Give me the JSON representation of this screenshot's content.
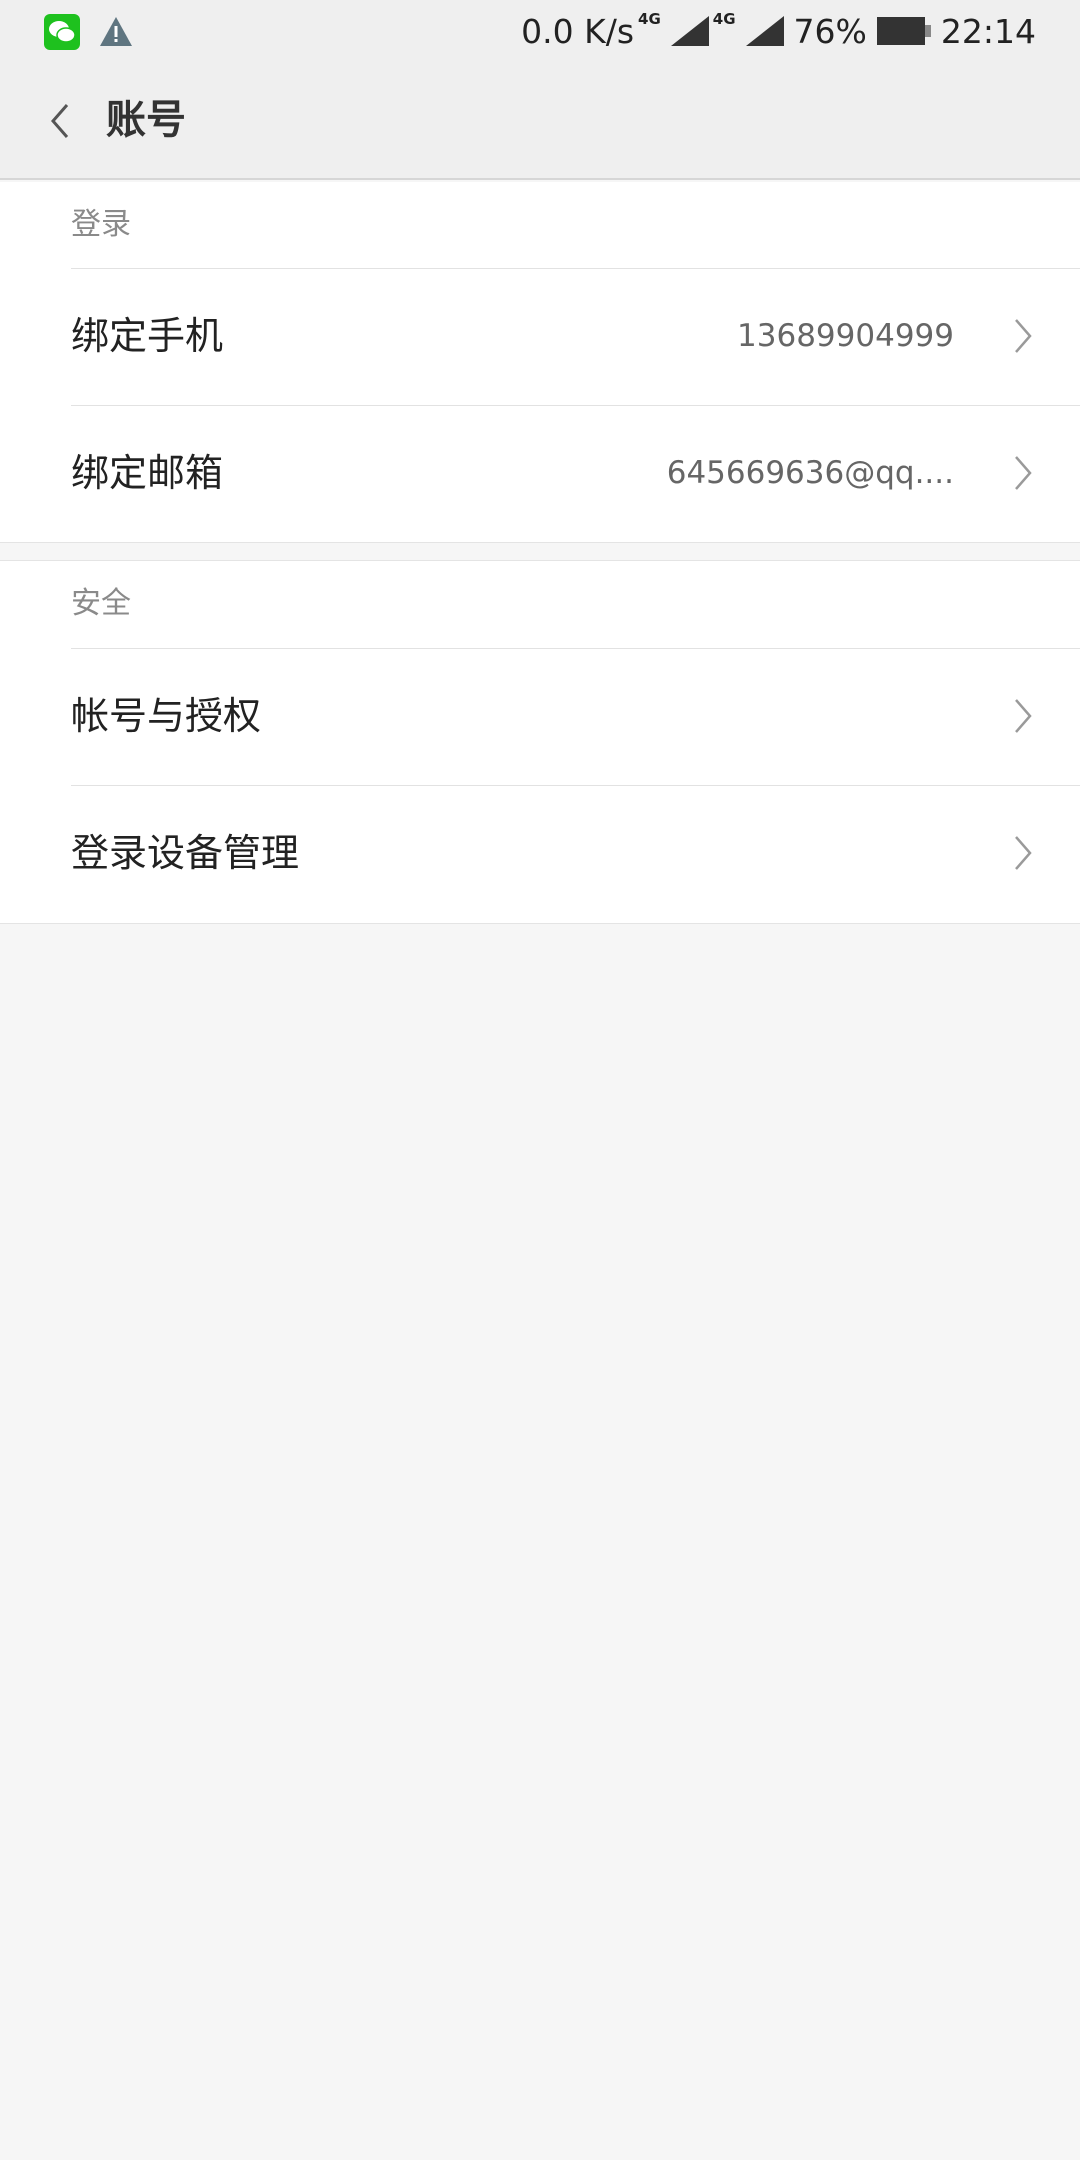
{
  "status_bar": {
    "net_speed": "0.0 K/s",
    "network_1": "4G",
    "network_2": "4G",
    "battery": "76%",
    "time": "22:14",
    "icons": [
      "wechat-icon",
      "warning-icon",
      "signal-icon",
      "battery-icon"
    ]
  },
  "toolbar": {
    "title": "账号",
    "back_icon": "chevron-left-icon"
  },
  "sections": [
    {
      "header": "登录",
      "rows": [
        {
          "label": "绑定手机",
          "value": "13689904999"
        },
        {
          "label": "绑定邮箱",
          "value": "645669636@qq...."
        }
      ]
    },
    {
      "header": "安全",
      "rows": [
        {
          "label": "帐号与授权",
          "value": ""
        },
        {
          "label": "登录设备管理",
          "value": ""
        }
      ]
    }
  ],
  "colors": {
    "background": "#f6f6f6",
    "toolbar": "#efefef",
    "card": "#ffffff",
    "header_text": "#8a8a8a",
    "accent_wechat": "#1ec11e"
  }
}
